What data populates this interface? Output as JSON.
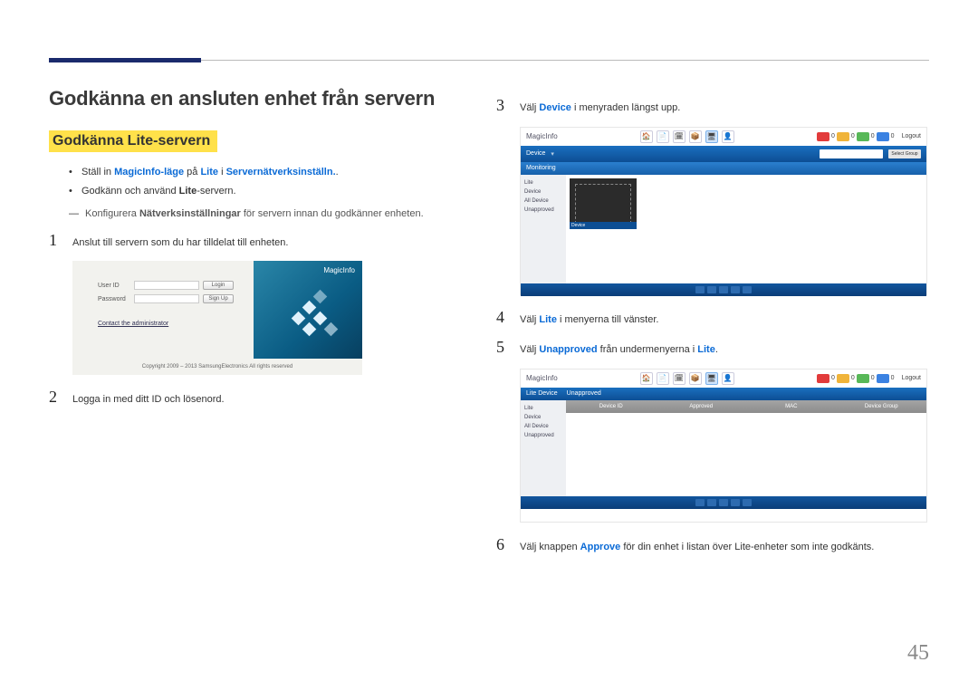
{
  "page_number": "45",
  "heading": "Godkänna en ansluten enhet från servern",
  "subheading": "Godkänna Lite-servern",
  "bullets": [
    {
      "pre": "Ställ in ",
      "hl1": "MagicInfo-läge",
      "mid1": " på ",
      "hl2": "Lite",
      "mid2": " i ",
      "hl3": "Servernätverksinställn.",
      "post": "."
    },
    {
      "pre": "Godkänn och använd ",
      "hl1": "Lite",
      "post": "-servern."
    }
  ],
  "note": {
    "dash": "―",
    "pre": "Konfigurera ",
    "hl": "Nätverksinställningar",
    "post": " för servern innan du godkänner enheten."
  },
  "steps_left": [
    {
      "n": "1",
      "text": "Anslut till servern som du har tilldelat till enheten."
    },
    {
      "n": "2",
      "text": "Logga in med ditt ID och lösenord."
    }
  ],
  "steps_right": [
    {
      "n": "3",
      "pre": "Välj ",
      "hl": "Device",
      "post": " i menyraden längst upp."
    },
    {
      "n": "4",
      "pre": "Välj ",
      "hl": "Lite",
      "post": " i menyerna till vänster."
    },
    {
      "n": "5",
      "pre": "Välj ",
      "hl": "Unapproved",
      "post_pre": " från undermenyerna i ",
      "post_hl": "Lite",
      "post": "."
    },
    {
      "n": "6",
      "pre": "Välj knappen ",
      "hl": "Approve",
      "post": " för din enhet i listan över Lite-enheter som inte godkänts."
    }
  ],
  "login": {
    "user_label": "User ID",
    "pass_label": "Password",
    "login_btn": "Login",
    "signup_btn": "Sign Up",
    "admin_link": "Contact the administrator",
    "copyright": "Copyright 2009 – 2013 SamsungElectronics All rights reserved",
    "logo": "MagicInfo"
  },
  "app": {
    "brand": "MagicInfo",
    "top_icons": [
      "🏠",
      "📄",
      "🗓",
      "📦",
      "🖥",
      "👤"
    ],
    "status_colors": [
      "#e23b3b",
      "#f0b43a",
      "#58b858",
      "#3b82e2"
    ],
    "status_num": "0",
    "logout": "Logout",
    "menu_label": "Device",
    "dropdown": "",
    "select_btn": "Select Group",
    "subtab": "Monitoring",
    "side_items": [
      "Lite",
      "Device",
      "All Device",
      "Unapproved"
    ],
    "thumb_caption": "Device",
    "table_cols_b": [
      "Device ID",
      "Approved",
      "MAC",
      "Device Group"
    ],
    "subtabs_b": [
      "Lite Device",
      "Unapproved"
    ]
  }
}
